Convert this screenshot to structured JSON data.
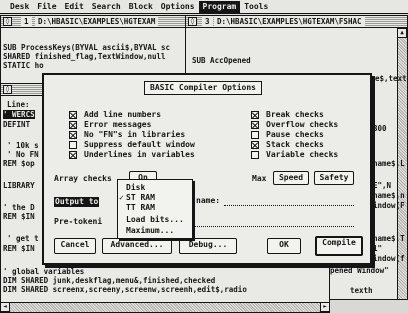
{
  "menu": [
    "Desk",
    "File",
    "Edit",
    "Search",
    "Block",
    "Options",
    "Program",
    "Tools"
  ],
  "menu_active_index": 6,
  "windows": {
    "back": {
      "number": "1",
      "title": "D:\\HBASIC\\EXAMPLES\\HGTEXAM",
      "lines": [
        "SUB ProcessKeys(BYVAL ascii$,BYVAL sc",
        "SHARED finished_flag,TextWindow,null",
        "STATIC ho"
      ]
    },
    "right": {
      "number": "3",
      "title": "D:\\HBASIC\\EXAMPLES\\HGTEXAM\\FSHAC",
      "lines": [
        "SUB AccOpened"
      ]
    },
    "right_partial_lines": [
      "e$,textH",
      "300",
      "name$,L",
      "E\",N",
      "name$,n",
      "indow(F",
      "name$,T",
      "1\"",
      "indow(f",
      "pened Window\"",
      "texth"
    ],
    "lower_lines": [
      "' global variables",
      "DIM SHARED junk,deskflag,menu&,finished,checked",
      "DIM SHARED screenx,screeny,screenw,screenh,edit$,radio"
    ],
    "left_fragments": [
      "Line:",
      "' WERCS",
      "DEFINT",
      "' 10k s",
      "' No FN",
      "REM $op",
      "LIBRARY",
      "' the D",
      "REM $IN",
      "' get t",
      "REM $IN"
    ]
  },
  "dialog": {
    "title": "BASIC Compiler Options",
    "left_options": [
      {
        "label": "Add line numbers",
        "checked": true
      },
      {
        "label": "Error messages",
        "checked": true
      },
      {
        "label": "No \"FN\"s in libraries",
        "checked": true
      },
      {
        "label": "Suppress default window",
        "checked": false
      },
      {
        "label": "Underlines in variables",
        "checked": true
      }
    ],
    "right_options": [
      {
        "label": "Break checks",
        "checked": true
      },
      {
        "label": "Overflow checks",
        "checked": true
      },
      {
        "label": "Pause checks",
        "checked": false
      },
      {
        "label": "Stack checks",
        "checked": true
      },
      {
        "label": "Variable checks",
        "checked": false
      }
    ],
    "array_checks_label": "Array checks",
    "array_checks_value": "On",
    "max_label": "Max",
    "speed_button": "Speed",
    "safety_button": "Safety",
    "output_label": "Output to",
    "name_label": "name:",
    "pretoken_label": "Pre-tokeni",
    "buttons": {
      "cancel": "Cancel",
      "advanced": "Advanced...",
      "debug": "Debug...",
      "ok": "OK",
      "compile": "Compile"
    }
  },
  "popup": {
    "items": [
      "Disk",
      "ST RAM",
      "TT RAM",
      "Load bits...",
      "Maximum..."
    ],
    "checked_index": 1
  },
  "icons": {
    "close": "close-box-icon",
    "check": "check-mark-icon",
    "arrow_up": "scroll-up-arrow-icon",
    "arrow_down": "scroll-down-arrow-icon",
    "arrow_left": "scroll-left-arrow-icon",
    "arrow_right": "scroll-right-arrow-icon"
  }
}
